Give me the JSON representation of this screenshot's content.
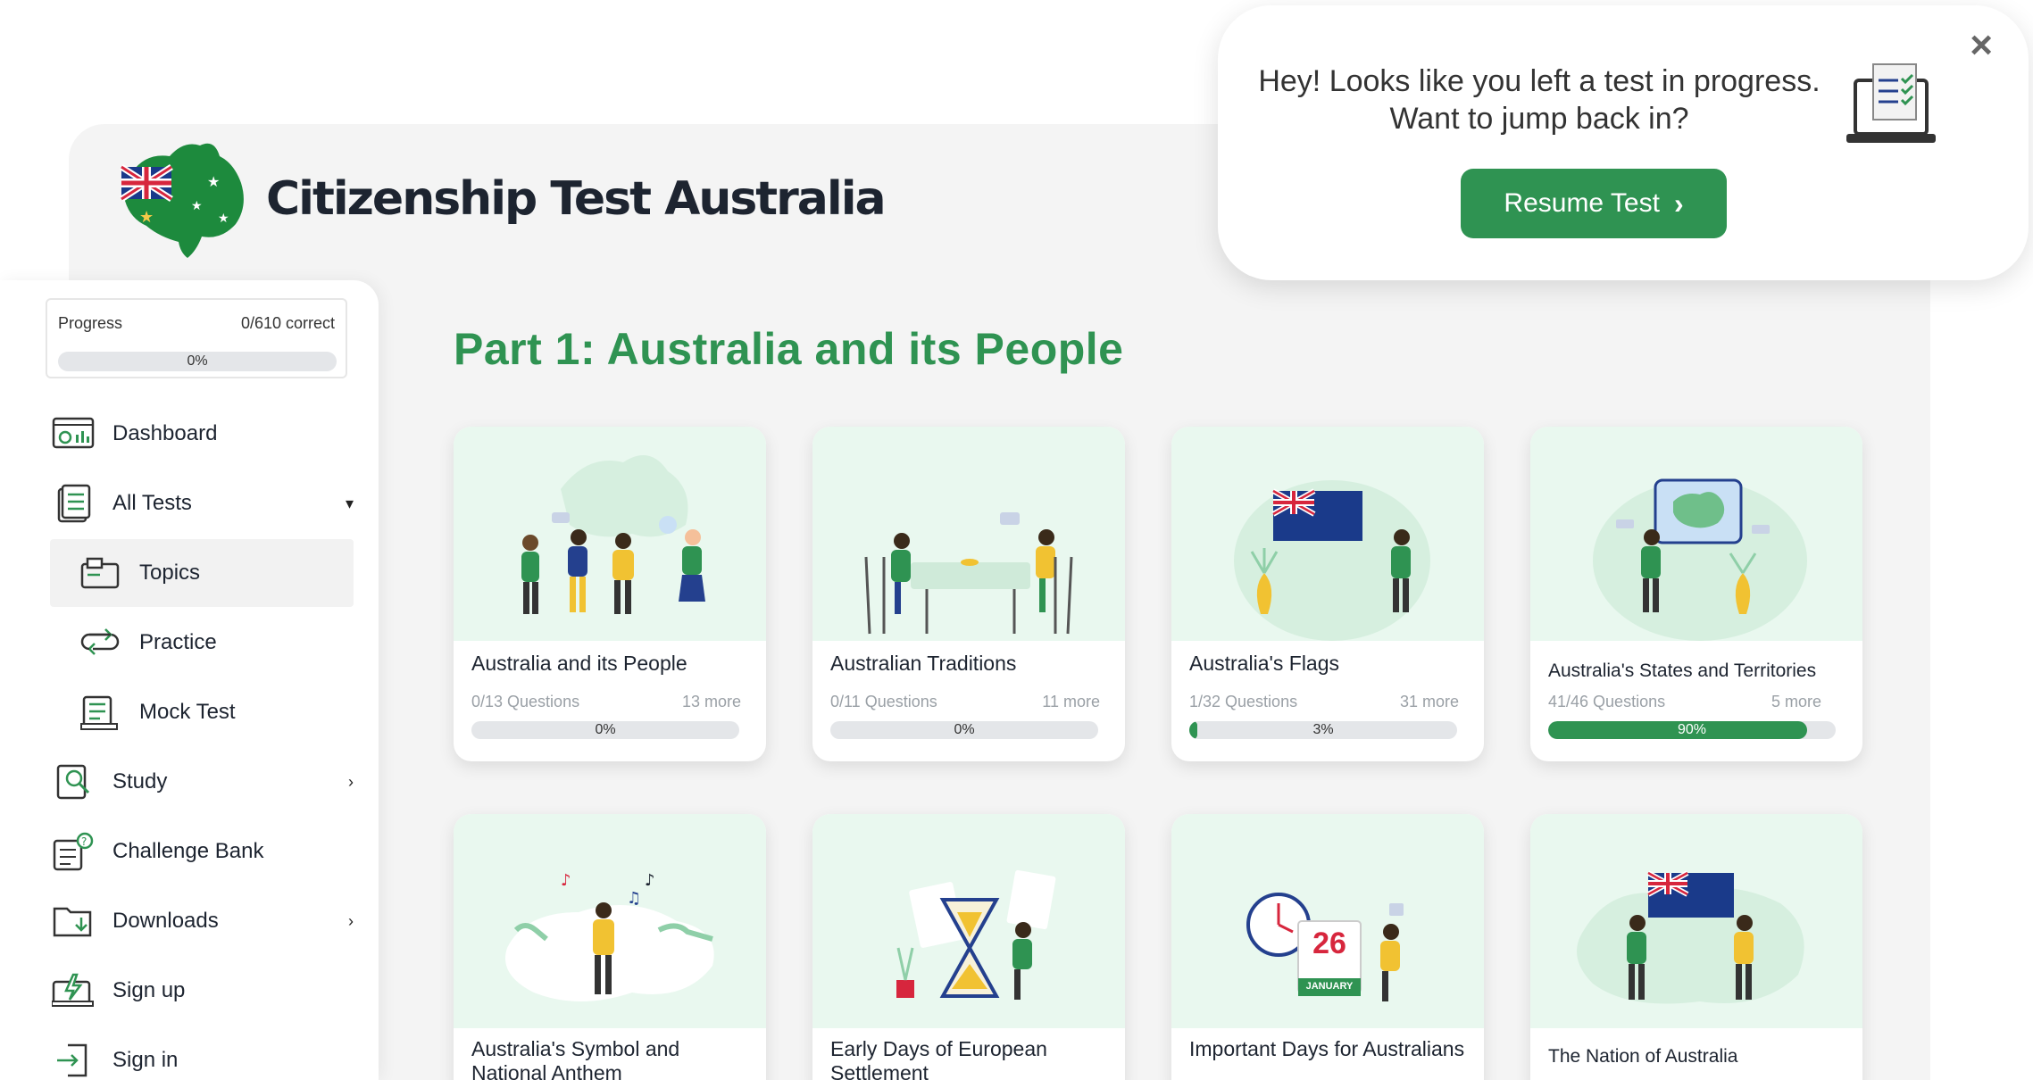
{
  "brand": {
    "title": "Citizenship Test Australia"
  },
  "progress": {
    "label": "Progress",
    "count": "0/610 correct",
    "percent": "0%",
    "value": 0
  },
  "nav": {
    "dashboard": "Dashboard",
    "all_tests": "All Tests",
    "topics": "Topics",
    "practice": "Practice",
    "mock_test": "Mock Test",
    "study": "Study",
    "challenge_bank": "Challenge Bank",
    "downloads": "Downloads",
    "sign_up": "Sign up",
    "sign_in": "Sign in"
  },
  "main": {
    "part_title": "Part 1: Australia and its People"
  },
  "cards": [
    {
      "title": "Australia and its People",
      "questions": "0/13 Questions",
      "more": "13 more",
      "percent": "0%",
      "value": 0
    },
    {
      "title": "Australian Traditions",
      "questions": "0/11 Questions",
      "more": "11 more",
      "percent": "0%",
      "value": 0
    },
    {
      "title": "Australia's Flags",
      "questions": "1/32 Questions",
      "more": "31 more",
      "percent": "3%",
      "value": 3
    },
    {
      "title": "Australia's States and Territories",
      "questions": "41/46 Questions",
      "more": "5 more",
      "percent": "90%",
      "value": 90
    },
    {
      "title": "Australia's Symbol and National Anthem"
    },
    {
      "title": "Early Days of European Settlement"
    },
    {
      "title": "Important Days for Australians",
      "calendar_day": "26",
      "calendar_month": "JANUARY"
    },
    {
      "title": "The Nation of Australia"
    }
  ],
  "popup": {
    "message_line1": "Hey! Looks like you left a test in progress.",
    "message_line2": "Want to jump back in?",
    "button": "Resume Test",
    "close": "×"
  },
  "colors": {
    "accent": "#2f9352",
    "card_bg": "#e9f8ef",
    "text": "#1d2430"
  }
}
